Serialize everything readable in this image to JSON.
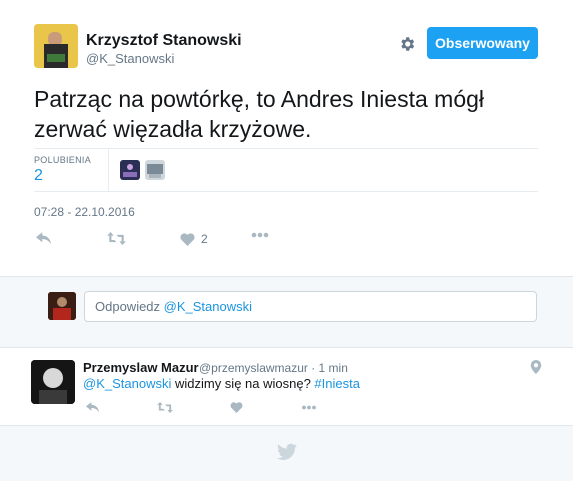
{
  "tweet": {
    "author_name": "Krzysztof Stanowski",
    "author_handle": "@K_Stanowski",
    "follow_label": "Obserwowany",
    "text": "Patrząc na powtórkę, to Andres Iniesta mógł zerwać więzadła krzyżowe.",
    "likes_label": "POLUBIENIA",
    "likes_count": "2",
    "timestamp": "07:28 - 22.10.2016",
    "actions": {
      "reply_icon": "reply-icon",
      "retweet_icon": "retweet-icon",
      "like_icon": "heart-icon",
      "like_count": "2",
      "more_icon": "more-icon"
    }
  },
  "compose": {
    "placeholder_prefix": "Odpowiedz ",
    "placeholder_mention": "@K_Stanowski"
  },
  "reply": {
    "author_name": "Przemyslaw Mazur",
    "author_meta": "@przemyslawmazur · 1 min",
    "mention": "@K_Stanowski",
    "text": " widzimy się na wiosnę? ",
    "hashtag": "#Iniesta"
  },
  "colors": {
    "accent": "#1da1f2",
    "link": "#1b95e0",
    "muted": "#657786",
    "icon": "#aab8c2"
  }
}
